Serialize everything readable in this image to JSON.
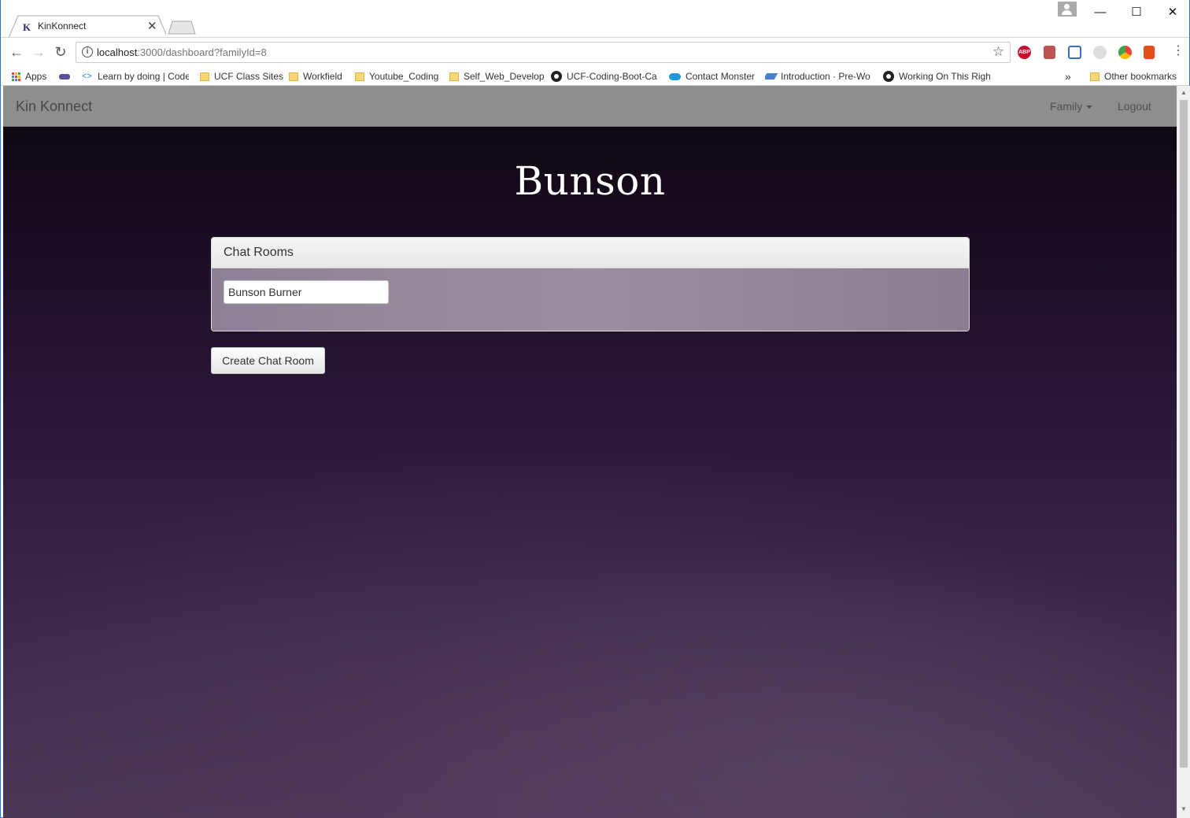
{
  "browser": {
    "tab_title": "KinKonnect",
    "tab_favicon": "K",
    "url_host": "localhost",
    "url_rest": ":3000/dashboard?familyId=8",
    "bookmarks": [
      {
        "label": "Apps",
        "icon": "apps-icon"
      },
      {
        "label": "",
        "icon": "extension-icon"
      },
      {
        "label": "Learn by doing | Code",
        "icon": "code-icon"
      },
      {
        "label": "UCF Class Sites",
        "icon": "folder-icon"
      },
      {
        "label": "Workfield",
        "icon": "folder-icon"
      },
      {
        "label": "Youtube_Coding",
        "icon": "folder-icon"
      },
      {
        "label": "Self_Web_Develop",
        "icon": "folder-icon"
      },
      {
        "label": "UCF-Coding-Boot-Ca",
        "icon": "github-icon"
      },
      {
        "label": "Contact Monster",
        "icon": "cloud-icon"
      },
      {
        "label": "Introduction · Pre-Wo",
        "icon": "layers-icon"
      },
      {
        "label": "Working On This Righ",
        "icon": "github-icon"
      }
    ],
    "overflow_label": "»",
    "other_bookmarks": "Other bookmarks"
  },
  "app": {
    "brand": "Kin Konnect",
    "nav_family": "Family",
    "nav_logout": "Logout",
    "family_name": "Bunson",
    "panel_title": "Chat Rooms",
    "room_name": "Bunson Burner",
    "create_button": "Create Chat Room"
  },
  "colors": {
    "navbar": "#8e8e8e",
    "panel_body": "#958a9b",
    "background_top": "#0b060c",
    "background_bottom": "#4a3655"
  }
}
